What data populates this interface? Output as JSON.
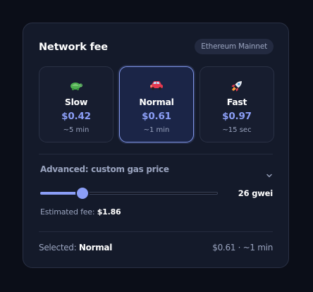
{
  "header": {
    "title": "Network fee",
    "network": "Ethereum Mainnet"
  },
  "speeds": [
    {
      "label": "Slow",
      "price": "$0.42",
      "time": "~5 min",
      "icon": "turtle-icon"
    },
    {
      "label": "Normal",
      "price": "$0.61",
      "time": "~1 min",
      "icon": "car-icon",
      "selected": true
    },
    {
      "label": "Fast",
      "price": "$0.97",
      "time": "~15 sec",
      "icon": "rocket-icon"
    }
  ],
  "advanced": {
    "label": "Advanced: custom gas price",
    "gas_value": "26 gwei",
    "slider_fraction": 0.24,
    "estimated_label": "Estimated fee: ",
    "estimated_value": "$1.86"
  },
  "summary": {
    "label": "Selected: ",
    "value": "Normal",
    "detail": "$0.61 · ~1 min"
  },
  "colors": {
    "accent": "#8b9ef6",
    "card_background": "#141a2a",
    "page_background": "#0b0e18",
    "selected_border": "#7f95e8"
  }
}
